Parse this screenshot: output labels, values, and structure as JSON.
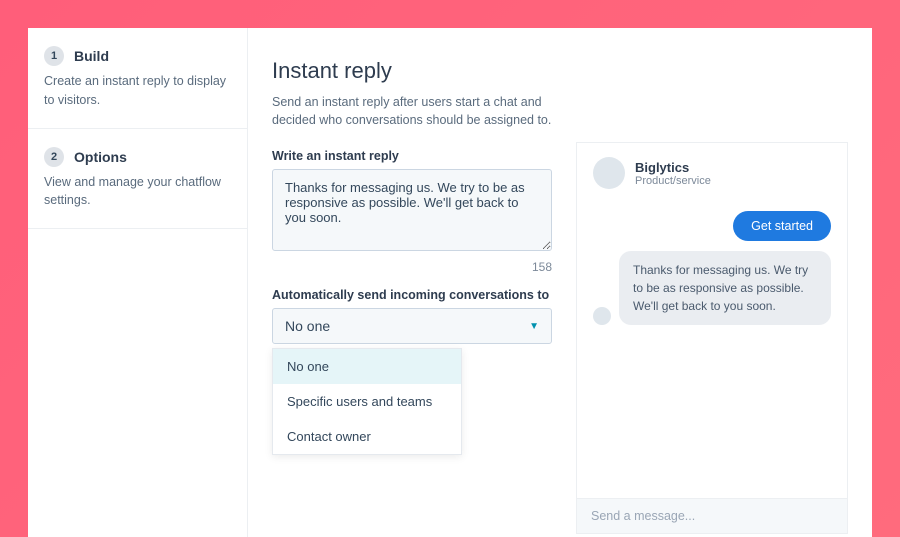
{
  "sidebar": {
    "steps": [
      {
        "num": "1",
        "title": "Build",
        "desc": "Create an instant reply to display to visitors."
      },
      {
        "num": "2",
        "title": "Options",
        "desc": "View and manage your chatflow settings."
      }
    ]
  },
  "main": {
    "heading": "Instant reply",
    "subhead": "Send an instant reply after users start a chat and decided who conversations should be assigned to.",
    "write_label": "Write an instant reply",
    "reply_text": "Thanks for messaging us. We try to be as responsive as possible. We'll get back to you soon.",
    "char_count": "158",
    "route_label": "Automatically send incoming conversations to",
    "selected": "No one",
    "options": [
      "No one",
      "Specific users and teams",
      "Contact owner"
    ]
  },
  "preview": {
    "company": "Biglytics",
    "subtitle": "Product/service",
    "get_started": "Get started",
    "bubble": "Thanks for messaging us. We try to be as responsive as possible. We'll get back to you soon.",
    "compose_placeholder": "Send a message..."
  }
}
